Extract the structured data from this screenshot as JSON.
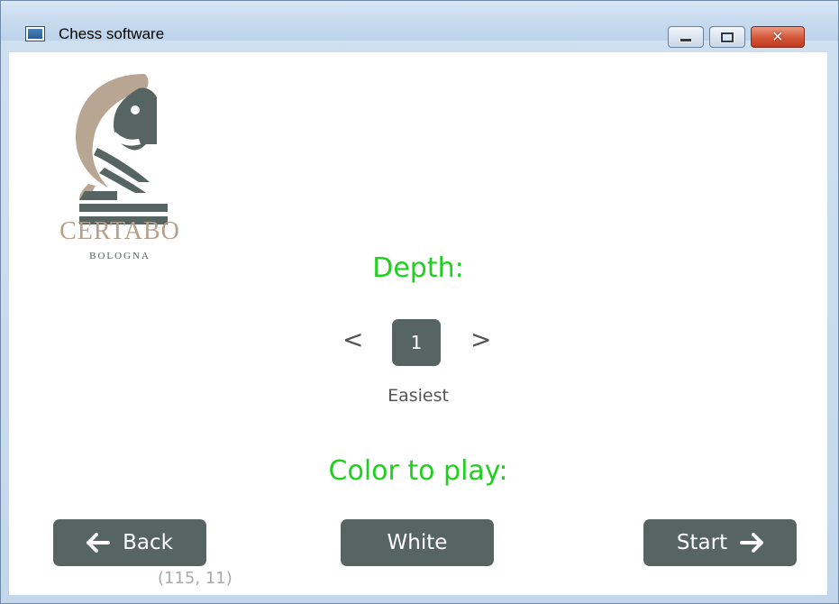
{
  "window": {
    "title": "Chess software",
    "icon": "app-window-icon",
    "controls": {
      "minimize_icon": "minimize-icon",
      "maximize_icon": "maximize-icon",
      "close_icon": "close-icon",
      "close_glyph": "✕"
    }
  },
  "logo": {
    "icon": "chess-knight-icon",
    "brand": "CERTABO",
    "subbrand": "BOLOGNA",
    "colors": {
      "tan": "#b8a592",
      "slate": "#566462"
    }
  },
  "depth": {
    "heading": "Depth:",
    "prev_label": "<",
    "next_label": ">",
    "value": "1",
    "description": "Easiest"
  },
  "color": {
    "heading": "Color to play:",
    "selected": "White"
  },
  "buttons": {
    "back": {
      "label": "Back",
      "icon": "arrow-left-icon",
      "glyph": "🡐"
    },
    "start": {
      "label": "Start",
      "icon": "arrow-right-icon",
      "glyph": "🡒"
    }
  },
  "cursor_readout": "(115, 11)",
  "theme": {
    "accent_green": "#1fd01f",
    "button_bg": "#566462",
    "text_gray": "#555555",
    "readout_gray": "#aaaaaa"
  }
}
